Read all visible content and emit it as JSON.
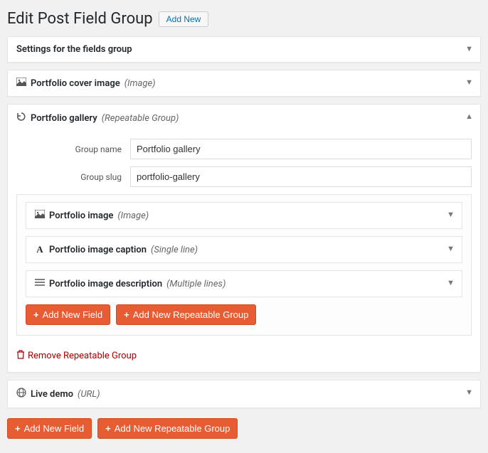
{
  "header": {
    "title": "Edit Post Field Group",
    "addNew": "Add New"
  },
  "panels": {
    "settings": {
      "title": "Settings for the fields group"
    },
    "coverImage": {
      "title": "Portfolio cover image",
      "type": "(Image)"
    },
    "gallery": {
      "title": "Portfolio gallery",
      "type": "(Repeatable Group)",
      "form": {
        "groupNameLabel": "Group name",
        "groupNameValue": "Portfolio gallery",
        "groupSlugLabel": "Group slug",
        "groupSlugValue": "portfolio-gallery"
      },
      "nested": {
        "image": {
          "title": "Portfolio image",
          "type": "(Image)"
        },
        "caption": {
          "title": "Portfolio image caption",
          "type": "(Single line)"
        },
        "description": {
          "title": "Portfolio image description",
          "type": "(Multiple lines)"
        }
      },
      "buttons": {
        "addField": "Add New Field",
        "addGroup": "Add New Repeatable Group",
        "removeGroup": "Remove Repeatable Group"
      }
    },
    "liveDemo": {
      "title": "Live demo",
      "type": "(URL)"
    }
  },
  "bottomButtons": {
    "addField": "Add New Field",
    "addGroup": "Add New Repeatable Group"
  }
}
